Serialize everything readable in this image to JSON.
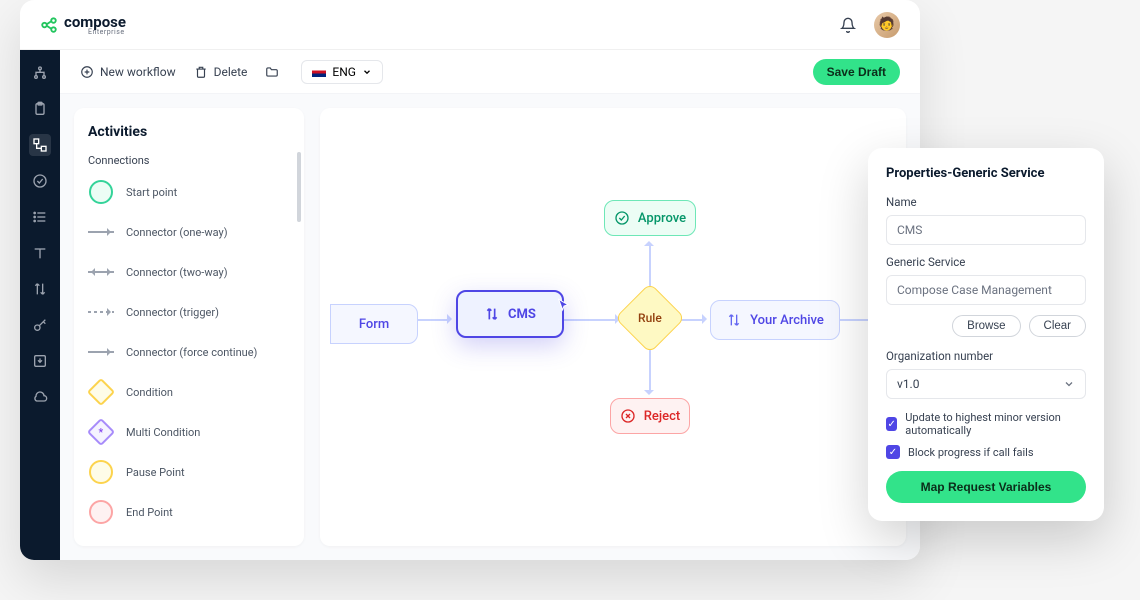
{
  "brand": {
    "name": "compose",
    "sub": "Enterprise"
  },
  "toolbar": {
    "new_workflow": "New workflow",
    "delete": "Delete",
    "language": "ENG",
    "save_draft": "Save Draft"
  },
  "activities": {
    "title": "Activities",
    "section": "Connections",
    "items": [
      "Start point",
      "Connector (one-way)",
      "Connector (two-way)",
      "Connector (trigger)",
      "Connector (force continue)",
      "Condition",
      "Multi Condition",
      "Pause Point",
      "End Point"
    ]
  },
  "canvas": {
    "form": "Form",
    "cms": "CMS",
    "approve": "Approve",
    "reject": "Reject",
    "rule": "Rule",
    "archive": "Your Archive"
  },
  "properties": {
    "title": "Properties-Generic Service",
    "name_label": "Name",
    "name_value": "CMS",
    "service_label": "Generic Service",
    "service_value": "Compose Case Management",
    "browse": "Browse",
    "clear": "Clear",
    "org_label": "Organization number",
    "org_value": "v1.0",
    "check1": "Update to highest minor version automatically",
    "check2": "Block progress if call fails",
    "map_btn": "Map Request Variables"
  }
}
